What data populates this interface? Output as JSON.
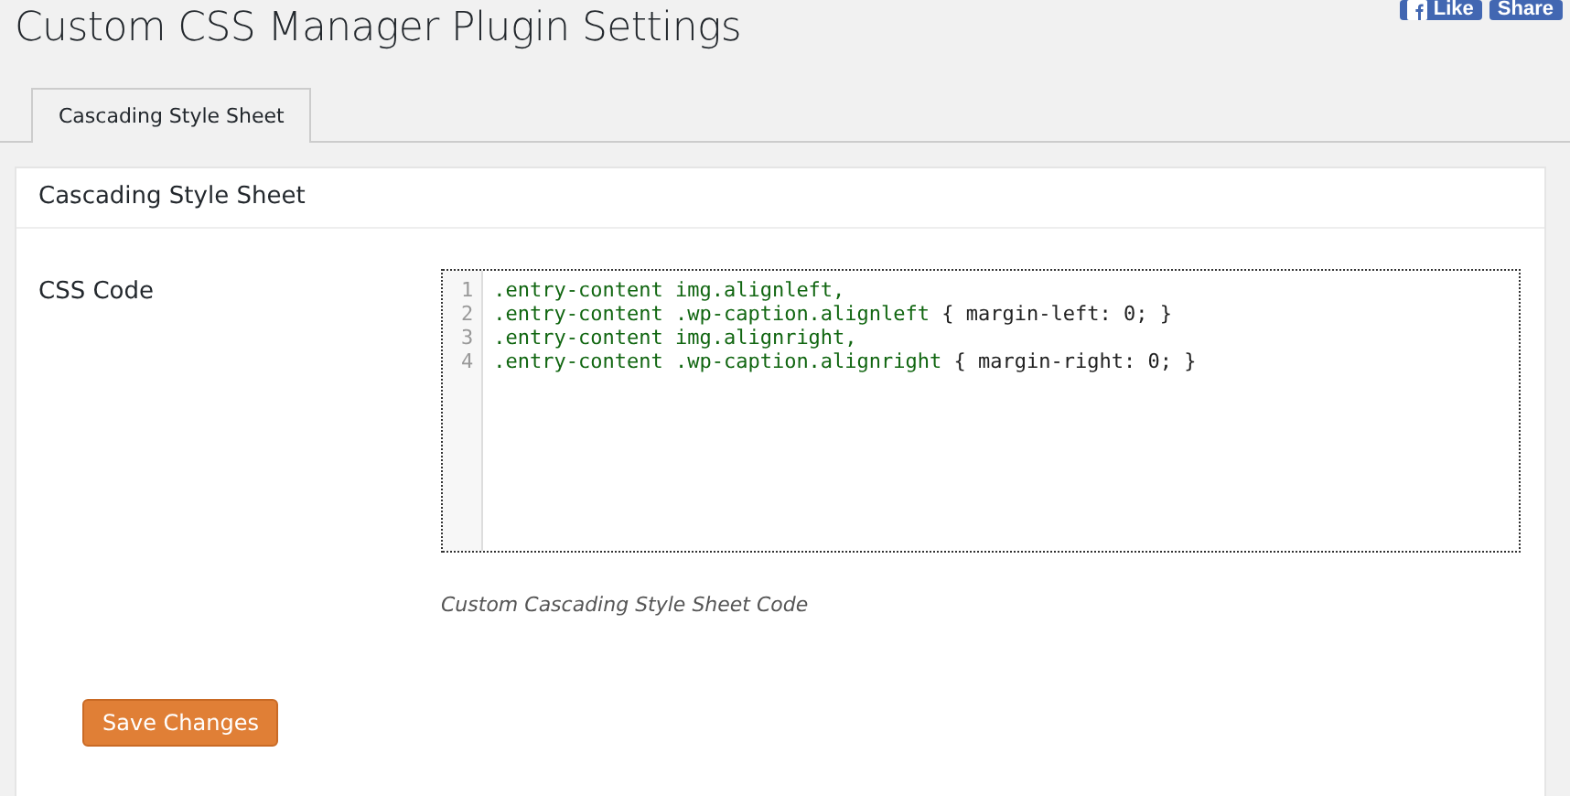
{
  "page_title": "Custom CSS Manager Plugin Settings",
  "social": [
    {
      "kind": "like",
      "label": "Like"
    },
    {
      "kind": "share",
      "label": "Share"
    }
  ],
  "tabs": [
    {
      "label": "Cascading Style Sheet",
      "selected": true
    }
  ],
  "panel": {
    "title": "Cascading Style Sheet",
    "field_label": "CSS Code",
    "code_lines": [
      {
        "number": "1",
        "tokens": [
          {
            "kind": "selector",
            "text": ".entry-content img.alignleft,"
          }
        ]
      },
      {
        "number": "2",
        "tokens": [
          {
            "kind": "selector",
            "text": ".entry-content .wp-caption.alignleft"
          },
          {
            "kind": "rule",
            "text": " { margin-left: 0; }"
          }
        ]
      },
      {
        "number": "3",
        "tokens": [
          {
            "kind": "selector",
            "text": ".entry-content img.alignright,"
          }
        ]
      },
      {
        "number": "4",
        "tokens": [
          {
            "kind": "selector",
            "text": ".entry-content .wp-caption.alignright"
          },
          {
            "kind": "rule",
            "text": " { margin-right: 0; }"
          }
        ]
      }
    ],
    "description": "Custom Cascading Style Sheet Code",
    "save_button": "Save Changes"
  }
}
